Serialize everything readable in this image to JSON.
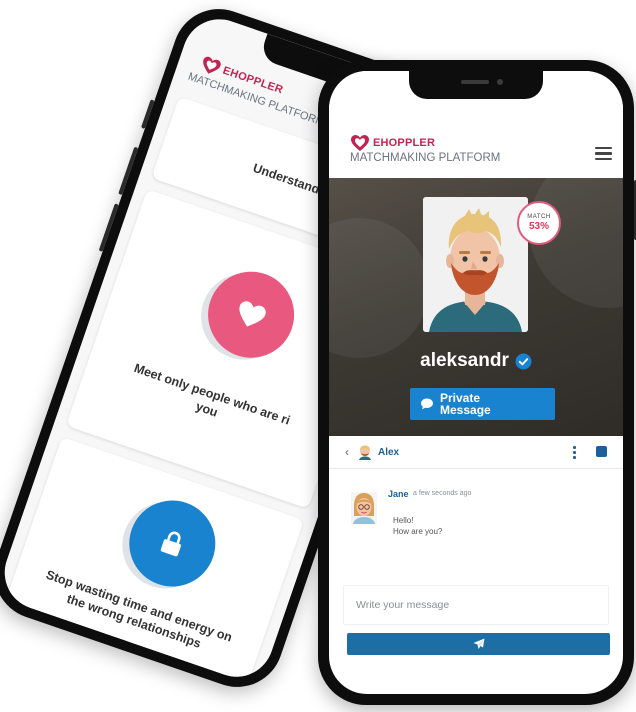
{
  "brand": {
    "logo_text": "EHOPPLER",
    "tagline": "MATCHMAKING PLATFORM",
    "color": "#c22451"
  },
  "back_phone": {
    "cards": [
      {
        "text": "Understand"
      },
      {
        "text_line1": "Meet only people who are ri",
        "text_line2": "you",
        "icon": "heart-icon",
        "color": "#e9587f"
      },
      {
        "text_line1": "Stop wasting time and energy on",
        "text_line2": "the wrong relationships",
        "icon": "lock-icon",
        "color": "#1a83cf"
      }
    ]
  },
  "profile": {
    "match_label": "MATCH",
    "match_value": "53%",
    "username": "aleksandr",
    "verified_icon": "verified-check-icon",
    "private_message_label": "Private Message"
  },
  "chat": {
    "back_icon": "‹",
    "contact_name": "Alex",
    "messages": [
      {
        "sender": "Jane",
        "time": "a few seconds ago",
        "line1": "Hello!",
        "line2": "How are you?"
      }
    ],
    "input_placeholder": "Write your message",
    "send_icon": "paper-plane-icon"
  },
  "colors": {
    "accent": "#1a83cf",
    "dark_accent": "#1e6ea6",
    "brand_red": "#c22451",
    "pink": "#e9587f"
  }
}
